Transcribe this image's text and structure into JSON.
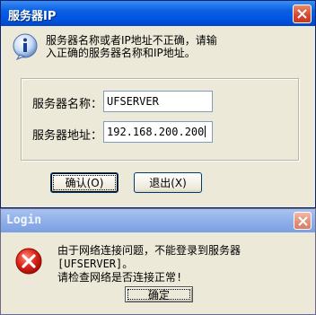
{
  "dialog1": {
    "title": "服务器IP",
    "message": "服务器名称或者IP地址不正确，请输\n入正确的服务器名称和IP地址。",
    "server_name_label": "服务器名称：",
    "server_name_value": "UFSERVER",
    "server_addr_label": "服务器地址：",
    "server_addr_value": "192.168.200.200",
    "ok_label": "确认(O)",
    "cancel_label": "退出(X)",
    "info_icon": "info-icon",
    "close_icon": "close-icon"
  },
  "dialog2": {
    "title": "Login",
    "message": "由于网络连接问题，不能登录到服务器[UFSERVER]。\n请检查网络是否连接正常!",
    "ok_label": "确定",
    "error_icon": "error-icon",
    "close_icon": "close-icon"
  },
  "colors": {
    "titlebar_active": "#0054e3",
    "titlebar_inactive": "#8fb0ea",
    "window_bg": "#ece9d8",
    "close_button": "#d6462c"
  }
}
